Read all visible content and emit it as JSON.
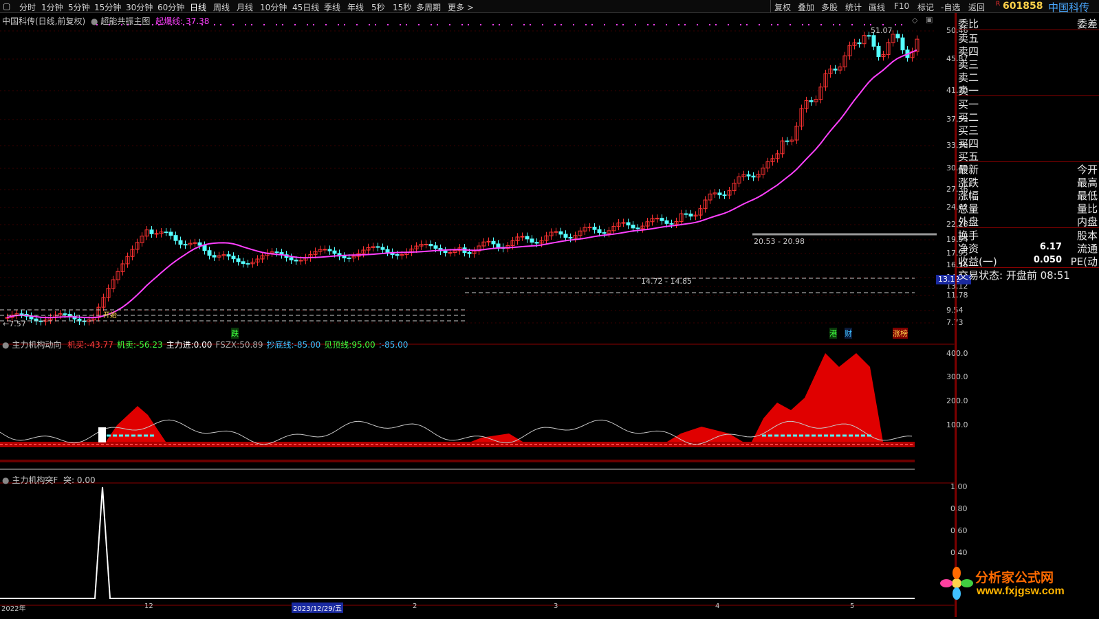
{
  "toolbar": {
    "periods": [
      "分时",
      "1分钟",
      "5分钟",
      "15分钟",
      "30分钟",
      "60分钟",
      "日线",
      "周线",
      "月线",
      "10分钟",
      "45日线",
      "季线",
      "年线",
      "5秒",
      "15秒",
      "多周期",
      "更多 >"
    ],
    "active_period": "日线",
    "actions": [
      "复权",
      "叠加",
      "多股",
      "统计",
      "画线",
      "F10",
      "标记",
      "-自选",
      "返回"
    ]
  },
  "stock": {
    "badge": "R",
    "code": "601858",
    "name": "中国科传"
  },
  "main_chart": {
    "title": "中国科传(日线,前复权)",
    "indicator": "超能共振主图",
    "indicator_line_label": "起爆线:",
    "indicator_line_value": "37.38",
    "price_ticks": [
      "50.46",
      "45.87",
      "41.70",
      "37.53",
      "33.78",
      "30.40",
      "27.36",
      "24.62",
      "22.16",
      "19.94",
      "17.95",
      "16.16",
      "14.54",
      "13.12",
      "11.78",
      "9.54",
      "7.73"
    ],
    "current_price_tag": "13.12",
    "high_label": "51.07",
    "low_label": "←7.57",
    "range_label_1": "20.53 - 20.98",
    "range_label_2": "14.72 - 14.85",
    "marker_start": "开始",
    "marker_drop": "跌",
    "marker_gang": "港",
    "marker_cai": "财",
    "marker_zhangbang": "涨榜"
  },
  "sub_chart_1": {
    "title": "主力机构动向",
    "items": [
      {
        "name": "机买:",
        "value": "-43.77",
        "color": "#ff4040"
      },
      {
        "name": "机卖:",
        "value": "-56.23",
        "color": "#40ff40"
      },
      {
        "name": "主力进:",
        "value": "0.00",
        "color": "#ffffff"
      },
      {
        "name": "FSZX:",
        "value": "50.89",
        "color": "#aaaaaa"
      },
      {
        "name": "抄底线:",
        "value": "-85.00",
        "color": "#40c0ff"
      },
      {
        "name": "见顶线:",
        "value": "95.00",
        "color": "#40ff40"
      },
      {
        "name": ":",
        "value": "-85.00",
        "color": "#40c0ff"
      }
    ],
    "ticks": [
      "400.0",
      "300.0",
      "200.0",
      "100.0"
    ]
  },
  "sub_chart_2": {
    "title": "主力机构突F",
    "value_label": "突:",
    "value": "0.00",
    "ticks": [
      "1.00",
      "0.80",
      "0.60",
      "0.40"
    ]
  },
  "date_axis": {
    "labels": [
      "2022年",
      "12",
      "2023/12/29/五",
      "2",
      "3",
      "4",
      "5"
    ]
  },
  "quote_panel": {
    "top_left": "委比",
    "top_right": "委差",
    "sell": [
      "卖五",
      "卖四",
      "卖三",
      "卖二",
      "卖一"
    ],
    "buy": [
      "买一",
      "买二",
      "买三",
      "买四",
      "买五"
    ],
    "stats": [
      {
        "left": "最新",
        "right": "今开"
      },
      {
        "left": "涨跌",
        "right": "最高"
      },
      {
        "left": "涨幅",
        "right": "最低"
      },
      {
        "left": "总量",
        "right": "量比"
      },
      {
        "left": "外盘",
        "right": "内盘"
      }
    ],
    "stats2": [
      {
        "left": "换手",
        "value": "",
        "right": "股本"
      },
      {
        "left": "净资",
        "value": "6.17",
        "right": "流通"
      },
      {
        "left": "收益(一)",
        "value": "0.050",
        "right": "PE(动"
      }
    ],
    "trade_status": "交易状态: 开盘前 08:51"
  },
  "watermark": {
    "line1": "分析家公式网",
    "line2": "www.fxjgsw.com"
  },
  "colors": {
    "up": "#ff3232",
    "down": "#54ffff",
    "ma": "#ff40ff",
    "accent": "#8b0000"
  }
}
